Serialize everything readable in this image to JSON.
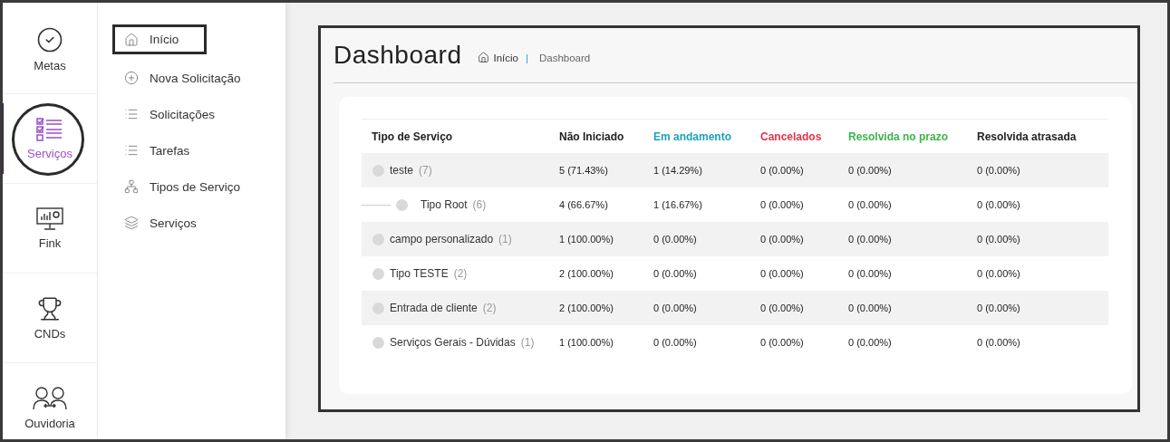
{
  "rail": [
    {
      "label": "Metas",
      "selected": false,
      "highlighted": false
    },
    {
      "label": "Serviços",
      "selected": true,
      "highlighted": true
    },
    {
      "label": "Fink",
      "selected": false,
      "highlighted": false
    },
    {
      "label": "CNDs",
      "selected": false,
      "highlighted": false
    },
    {
      "label": "Ouvidoria",
      "selected": false,
      "highlighted": false
    }
  ],
  "submenu": [
    {
      "label": "Início",
      "highlighted": true
    },
    {
      "label": "Nova Solicitação",
      "highlighted": false
    },
    {
      "label": "Solicitações",
      "highlighted": false
    },
    {
      "label": "Tarefas",
      "highlighted": false
    },
    {
      "label": "Tipos de Serviço",
      "highlighted": false
    },
    {
      "label": "Serviços",
      "highlighted": false
    }
  ],
  "page": {
    "title": "Dashboard",
    "breadcrumb": {
      "home": "Início",
      "separator": "|",
      "current": "Dashboard"
    }
  },
  "table": {
    "name_column": {
      "label": "Tipo de Serviço"
    },
    "status_columns": [
      {
        "label": "Não Iniciado",
        "color": "#222222"
      },
      {
        "label": "Em andamento",
        "color": "#1aa3b8"
      },
      {
        "label": "Cancelados",
        "color": "#e8324a"
      },
      {
        "label": "Resolvida no prazo",
        "color": "#3cb44b"
      },
      {
        "label": "Resolvida atrasada",
        "color": "#222222"
      }
    ],
    "rows": [
      {
        "name": "teste",
        "count": "(7)",
        "cells": [
          "5 (71.43%)",
          "1 (14.29%)",
          "0 (0.00%)",
          "0 (0.00%)",
          "0 (0.00%)"
        ],
        "children": [
          {
            "name": "Tipo Root",
            "count": "(6)",
            "cells": [
              "4 (66.67%)",
              "1 (16.67%)",
              "0 (0.00%)",
              "0 (0.00%)",
              "0 (0.00%)"
            ]
          }
        ]
      },
      {
        "name": "campo personalizado",
        "count": "(1)",
        "cells": [
          "1 (100.00%)",
          "0 (0.00%)",
          "0 (0.00%)",
          "0 (0.00%)",
          "0 (0.00%)"
        ]
      },
      {
        "name": "Tipo TESTE",
        "count": "(2)",
        "cells": [
          "2 (100.00%)",
          "0 (0.00%)",
          "0 (0.00%)",
          "0 (0.00%)",
          "0 (0.00%)"
        ]
      },
      {
        "name": "Entrada de cliente",
        "count": "(2)",
        "cells": [
          "2 (100.00%)",
          "0 (0.00%)",
          "0 (0.00%)",
          "0 (0.00%)",
          "0 (0.00%)"
        ]
      },
      {
        "name": "Serviços Gerais - Dúvidas",
        "count": "(1)",
        "cells": [
          "1 (100.00%)",
          "0 (0.00%)",
          "0 (0.00%)",
          "0 (0.00%)",
          "0 (0.00%)"
        ]
      }
    ]
  }
}
